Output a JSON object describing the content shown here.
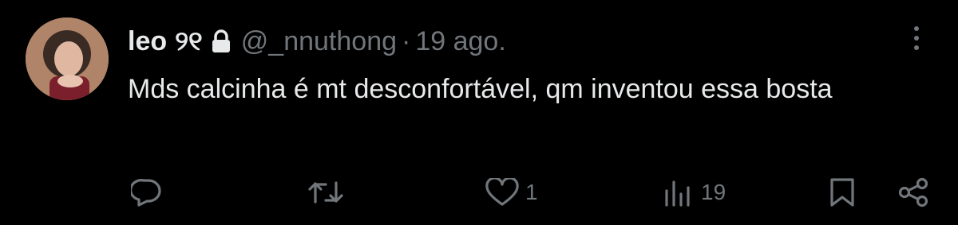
{
  "tweet": {
    "display_name": "leo",
    "name_emoji": "୨୧",
    "handle": "@_nnuthong",
    "separator": "·",
    "date": "19 ago.",
    "text": "Mds calcinha é mt desconfortável, qm inventou essa bosta",
    "protected": true
  },
  "actions": {
    "reply_count": "",
    "retweet_count": "",
    "like_count": "1",
    "views_count": "19"
  },
  "icons": {
    "reply": "reply-icon",
    "retweet": "retweet-icon",
    "like": "heart-icon",
    "views": "views-icon",
    "bookmark": "bookmark-icon",
    "share": "share-icon",
    "more": "more-icon",
    "lock": "lock-icon"
  },
  "colors": {
    "background": "#000000",
    "text": "#e7e9ea",
    "secondary": "#71767b"
  }
}
